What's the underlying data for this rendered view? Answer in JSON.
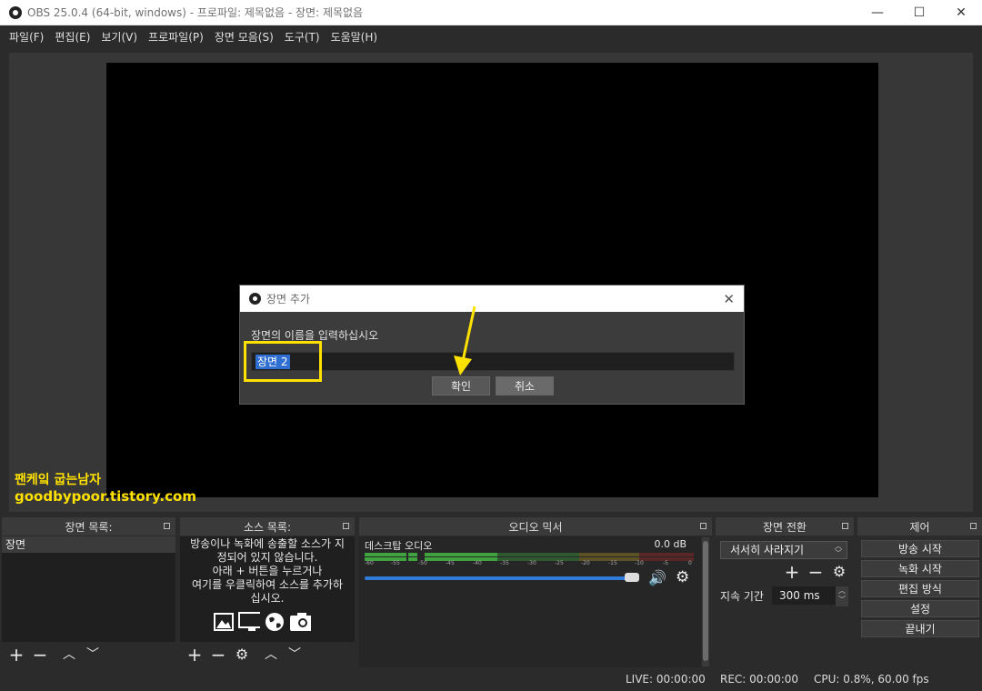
{
  "window": {
    "title": "OBS 25.0.4 (64-bit, windows) - 프로파일: 제목없음 - 장면: 제목없음",
    "minimize": "—",
    "maximize": "☐",
    "close": "✕"
  },
  "menu": [
    "파일(F)",
    "편집(E)",
    "보기(V)",
    "프로파일(P)",
    "장면 모음(S)",
    "도구(T)",
    "도움말(H)"
  ],
  "watermark": {
    "line1": "팬케잌 굽는남자",
    "line2": "goodbypoor.tistory.com"
  },
  "dialog": {
    "title": "장면 추가",
    "close": "✕",
    "prompt": "장면의 이름을 입력하십시오",
    "input_value": "장면 2",
    "ok": "확인",
    "cancel": "취소"
  },
  "docks": {
    "scenes": {
      "title": "장면 목록:",
      "items": [
        "장면"
      ]
    },
    "sources": {
      "title": "소스 목록:",
      "message": [
        "방송이나 녹화에 송출할 소스가 지",
        "정되어 있지 않습니다.",
        "아래 + 버튼을 누르거나",
        "여기를 우클릭하여 소스를 추가하",
        "십시오."
      ]
    },
    "mixer": {
      "title": "오디오 믹서",
      "channel": "데스크탑 오디오",
      "db": "0.0 dB",
      "ticks": [
        "-60",
        "-55",
        "-50",
        "-45",
        "-40",
        "-35",
        "-30",
        "-25",
        "-20",
        "-15",
        "-10",
        "-5",
        "0"
      ],
      "volume": 0.97
    },
    "transitions": {
      "title": "장면 전환",
      "selected": "서서히 사라지기",
      "duration_label": "지속 기간",
      "duration": "300 ms"
    },
    "controls": {
      "title": "제어",
      "buttons": [
        "방송 시작",
        "녹화 시작",
        "편집 방식",
        "설정",
        "끝내기"
      ]
    }
  },
  "status": {
    "live": "LIVE: 00:00:00",
    "rec": "REC: 00:00:00",
    "cpu": "CPU: 0.8%, 60.00 fps"
  },
  "colors": {
    "accent": "#2f7dd8",
    "highlight": "#ffe100",
    "meter_green": "#3fa33f",
    "meter_yellow": "#b59a2c",
    "meter_red": "#a83232"
  }
}
